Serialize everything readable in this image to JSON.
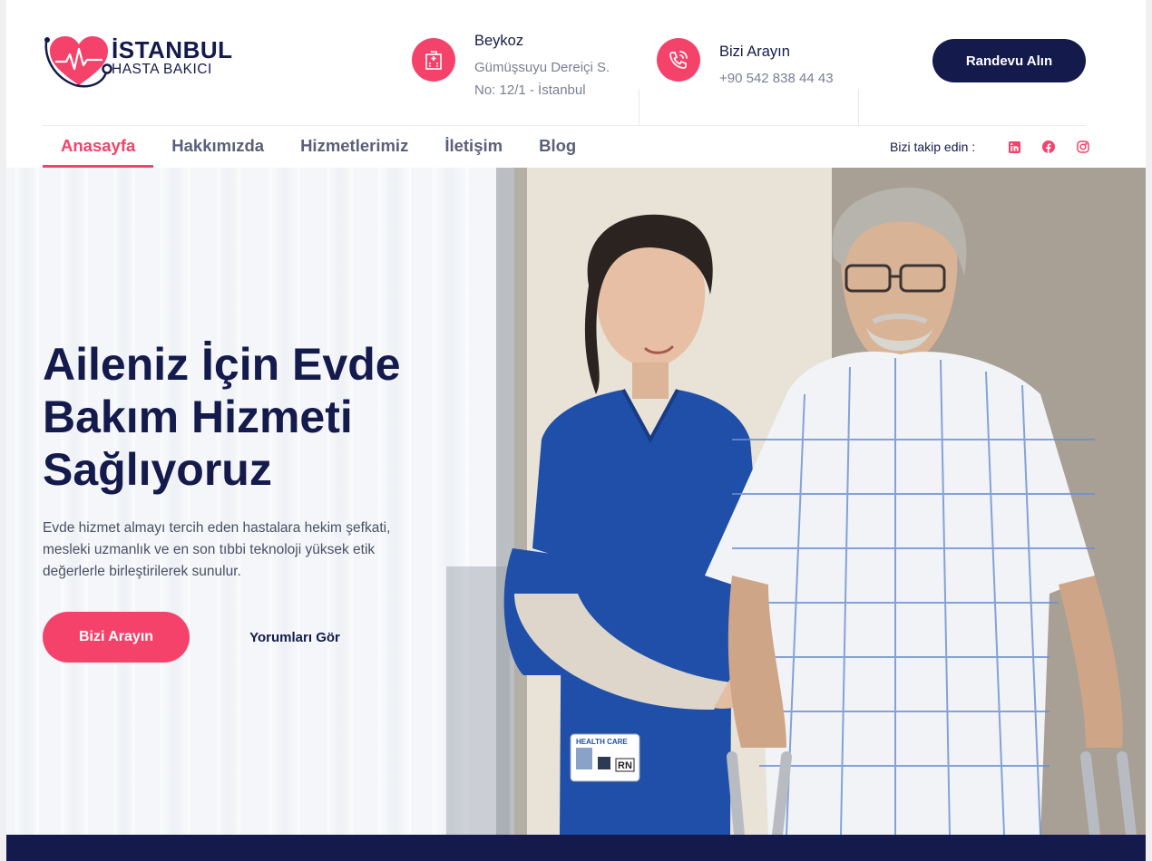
{
  "brand": {
    "line1": "İSTANBUL",
    "line2": "HASTA BAKICI"
  },
  "header": {
    "address": {
      "icon": "hospital-building-icon",
      "title": "Beykoz",
      "line1": "Gümüşsuyu Dereiçi S.",
      "line2": "No: 12/1 - İstanbul"
    },
    "phone": {
      "icon": "phone-call-icon",
      "title": "Bizi Arayın",
      "number": "+90 542 838 44 43"
    },
    "cta_label": "Randevu Alın"
  },
  "nav": {
    "items": [
      {
        "label": "Anasayfa",
        "active": true
      },
      {
        "label": "Hakkımızda",
        "active": false
      },
      {
        "label": "Hizmetlerimiz",
        "active": false
      },
      {
        "label": "İletişim",
        "active": false
      },
      {
        "label": "Blog",
        "active": false
      }
    ],
    "follow_label": "Bizi takip edin :",
    "social": [
      "linkedin-icon",
      "facebook-icon",
      "instagram-icon"
    ]
  },
  "hero": {
    "headline_1": "Aileniz İçin Evde",
    "headline_2": "Bakım Hizmeti",
    "headline_3": "Sağlıyoruz",
    "subtitle": "Evde hizmet almayı tercih eden hastalara hekim şefkati, mesleki uzmanlık ve en son tıbbi teknoloji yüksek etik değerlerle birleştirilerek sunulur.",
    "primary_button": "Bizi Arayın",
    "secondary_link": "Yorumları Gör",
    "badge_brand": "HEALTH CARE",
    "badge_role": "RN"
  },
  "colors": {
    "accent": "#f5426a",
    "navy": "#141a4b",
    "muted": "#7a7f95"
  }
}
